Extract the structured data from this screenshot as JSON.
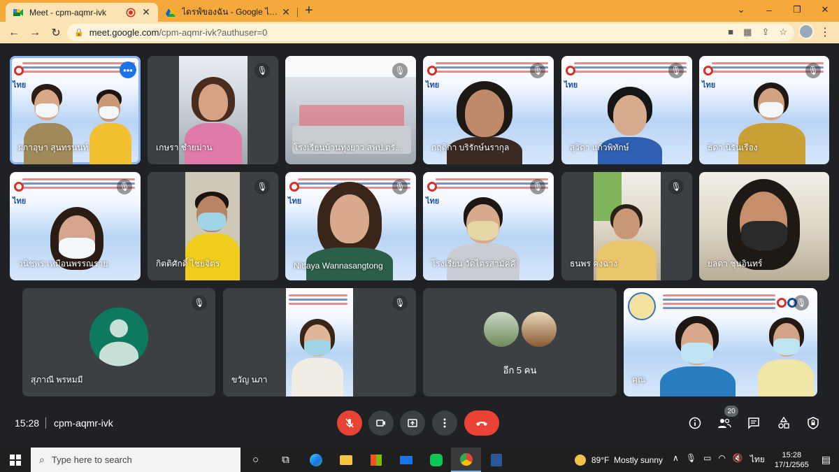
{
  "browser": {
    "tabs": [
      {
        "title": "Meet - cpm-aqmr-ivk",
        "active": true,
        "recording": true
      },
      {
        "title": "ไดรฟ์ของฉัน - Google ไดรฟ์",
        "active": false
      }
    ],
    "close_glyph": "✕",
    "new_tab_glyph": "+",
    "url_host": "meet.google.com",
    "url_path": "/cpm-aqmr-ivk?authuser=0",
    "window_controls": [
      "⌄",
      "–",
      "❐",
      "✕"
    ]
  },
  "meet": {
    "tiles": [
      {
        "name": "ผกาอุษา สุนทรนนท์",
        "backdrop": "poster",
        "speaking": true,
        "more_menu": true
      },
      {
        "name": "เกษรา ชำยม่าน",
        "backdrop": "room",
        "muted": true
      },
      {
        "name": "โรงเรียนบ้านทุ่งยาว สพป.ตรั...",
        "backdrop": "room",
        "muted": true
      },
      {
        "name": "กฤติกา บริรักษ์นรากุล",
        "backdrop": "poster",
        "muted": true
      },
      {
        "name": "สุวิดา แก้วพิทักษ์",
        "backdrop": "poster",
        "muted": true
      },
      {
        "name": "ธิดา นิรันเรือง",
        "backdrop": "poster",
        "muted": true
      },
      {
        "name": "วนิชพร เหมือนพรรณราย",
        "backdrop": "poster",
        "muted": true
      },
      {
        "name": "กิตติศักดิ์ ไชยจิตร",
        "backdrop": "room",
        "muted": true
      },
      {
        "name": "Nittaya Wannasangtong",
        "backdrop": "poster",
        "muted": true
      },
      {
        "name": "โรงเรียน วัดไตรสามัคคี",
        "backdrop": "poster",
        "muted": true
      },
      {
        "name": "ธนพร คงฉาง",
        "backdrop": "indoor",
        "muted": true
      },
      {
        "name": "ยลดา ชุนอินทร์",
        "backdrop": "indoor",
        "muted": false
      },
      {
        "name": "สุภาณี พรหมมี",
        "backdrop": "avatar",
        "muted": true
      },
      {
        "name": "ขวัญ นภา",
        "backdrop": "poster",
        "muted": true
      },
      {
        "name": "",
        "backdrop": "others",
        "muted": false,
        "others_label": "อีก 5 คน"
      },
      {
        "name": "คุณ",
        "backdrop": "poster",
        "muted": true,
        "self": true
      }
    ],
    "poster_logo_text": "ไทย"
  },
  "bottombar": {
    "time": "15:28",
    "meeting_code": "cpm-aqmr-ivk",
    "participant_count": "20",
    "controls": {
      "mic": "mic-off-icon",
      "camera": "camera-icon",
      "present": "present-icon",
      "more": "more-options-icon",
      "end": "end-call-icon"
    },
    "right_controls": [
      "info-icon",
      "people-icon",
      "chat-icon",
      "activities-icon",
      "host-controls-icon"
    ]
  },
  "taskbar": {
    "search_placeholder": "Type here to search",
    "weather_temp": "89°F",
    "weather_desc": "Mostly sunny",
    "language": "ไทย",
    "time": "15:28",
    "date": "17/1/2565"
  },
  "colors": {
    "accent": "#1a73e8",
    "end_call": "#ea4335",
    "tab_bar": "#f4a93a",
    "toolbar": "#fbe3b4",
    "meet_bg": "#202124",
    "tile_bg": "#3c4043"
  }
}
